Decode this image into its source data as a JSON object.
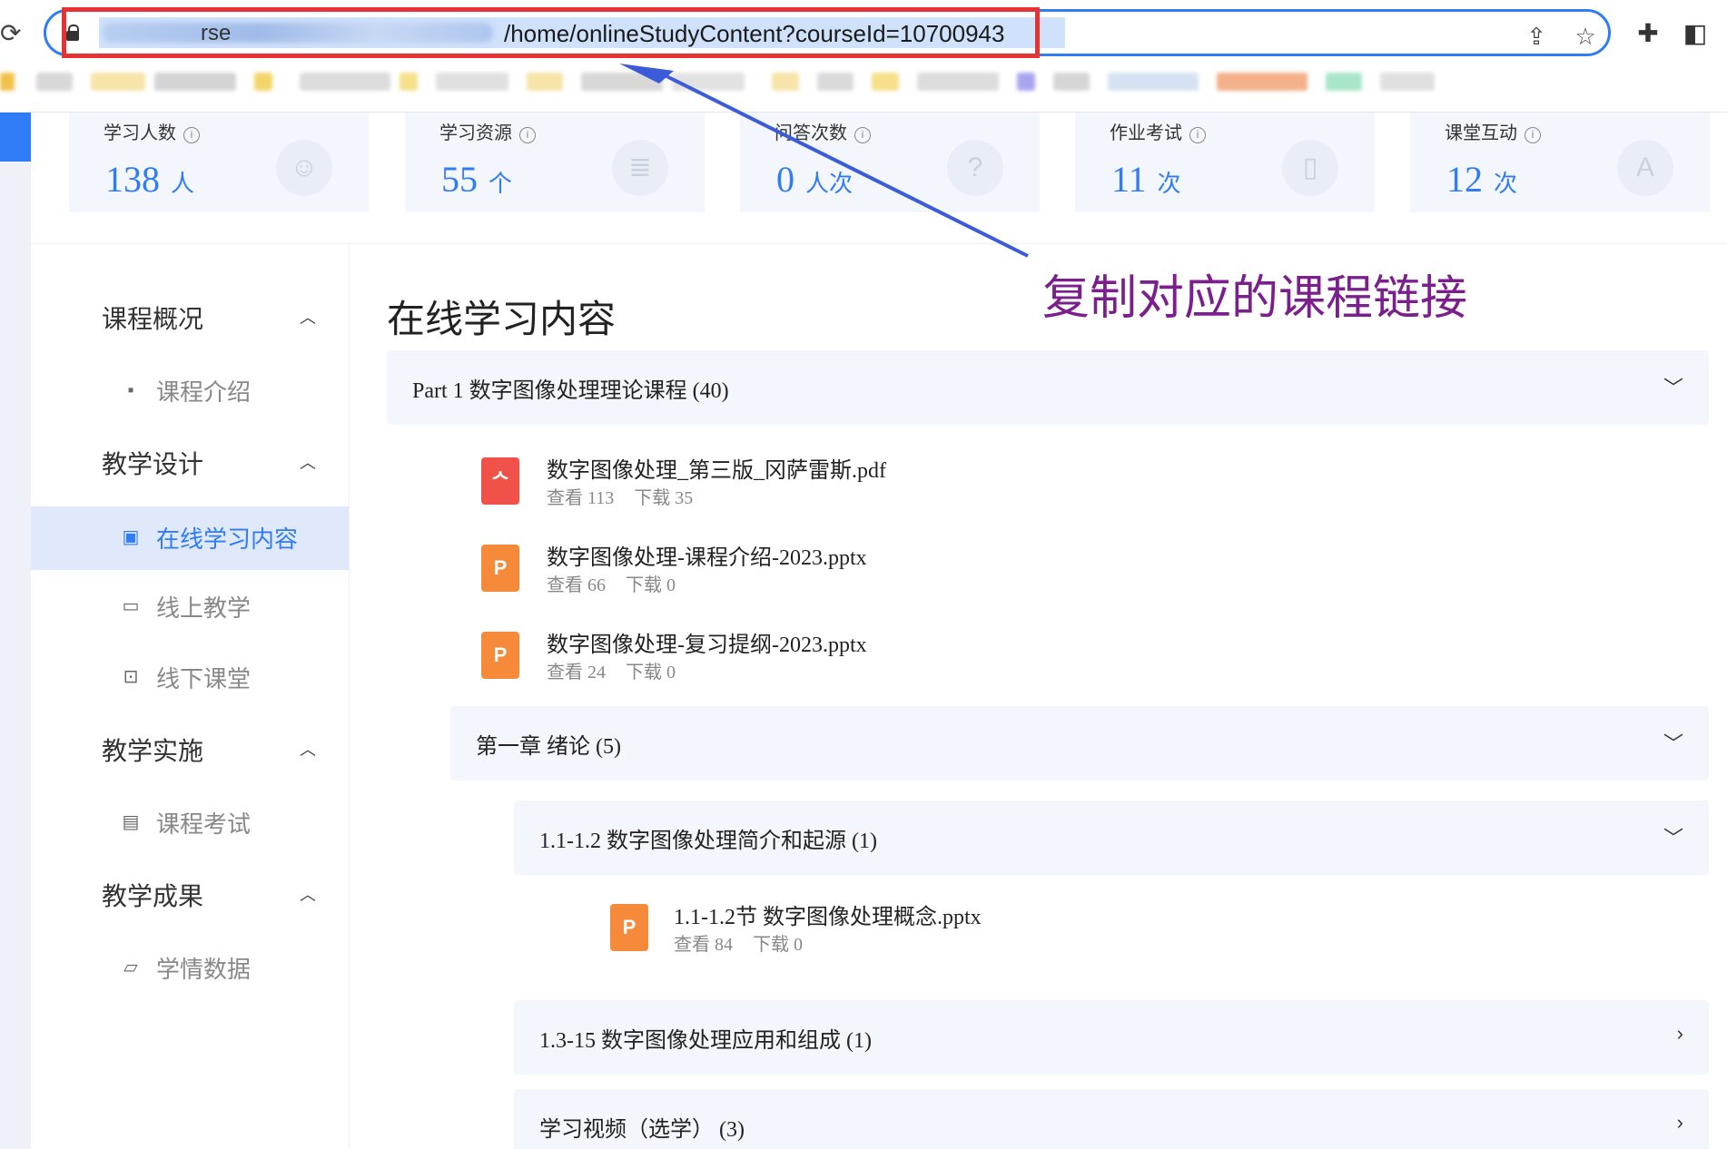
{
  "browser": {
    "url_visible": "/home/onlineStudyContent?courseId=10700943",
    "url_blurred_fragment": "rse",
    "icons": [
      "reload-icon",
      "lock-icon",
      "share-icon",
      "star-icon",
      "extensions-icon",
      "sidepanel-icon"
    ]
  },
  "stats": [
    {
      "label": "学习人数",
      "value": "138",
      "unit": "人",
      "icon": "student-icon"
    },
    {
      "label": "学习资源",
      "value": "55",
      "unit": "个",
      "icon": "database-icon"
    },
    {
      "label": "问答次数",
      "value": "0",
      "unit": "人次",
      "icon": "qa-icon"
    },
    {
      "label": "作业考试",
      "value": "11",
      "unit": "次",
      "icon": "book-icon"
    },
    {
      "label": "课堂互动",
      "value": "12",
      "unit": "次",
      "icon": "interaction-icon"
    }
  ],
  "sidebar": {
    "groups": [
      {
        "label": "课程概况",
        "items": [
          {
            "label": "课程介绍",
            "icon": "document-icon"
          }
        ]
      },
      {
        "label": "教学设计",
        "items": [
          {
            "label": "在线学习内容",
            "icon": "content-icon",
            "active": true
          },
          {
            "label": "线上教学",
            "icon": "online-class-icon"
          },
          {
            "label": "线下课堂",
            "icon": "offline-class-icon"
          }
        ]
      },
      {
        "label": "教学实施",
        "items": [
          {
            "label": "课程考试",
            "icon": "exam-icon"
          }
        ]
      },
      {
        "label": "教学成果",
        "items": [
          {
            "label": "学情数据",
            "icon": "chart-icon"
          }
        ]
      }
    ]
  },
  "main": {
    "title": "在线学习内容",
    "sections": [
      {
        "title": "Part 1 数字图像处理理论课程 (40)",
        "expanded": true
      },
      {
        "title": "第一章 绪论 (5)",
        "expanded": true
      },
      {
        "title": "1.1-1.2 数字图像处理简介和起源 (1)",
        "expanded": true
      },
      {
        "title": "1.3-15 数字图像处理应用和组成 (1)",
        "expanded": false
      },
      {
        "title": "学习视频（选学） (3)",
        "expanded": false
      }
    ],
    "files": [
      {
        "name": "数字图像处理_第三版_冈萨雷斯.pdf",
        "views": "查看 113",
        "downloads": "下载 35",
        "type": "pdf"
      },
      {
        "name": "数字图像处理-课程介绍-2023.pptx",
        "views": "查看 66",
        "downloads": "下载 0",
        "type": "ppt"
      },
      {
        "name": "数字图像处理-复习提纲-2023.pptx",
        "views": "查看 24",
        "downloads": "下载 0",
        "type": "ppt"
      },
      {
        "name": "1.1-1.2节 数字图像处理概念.pptx",
        "views": "查看 84",
        "downloads": "下载 0",
        "type": "ppt"
      }
    ],
    "ppt_letter": "P"
  },
  "annotation": {
    "text": "复制对应的课程链接",
    "color": "#7a1f8c",
    "arrow_color": "#3b5bdb",
    "frame_color": "#e63232"
  },
  "colors": {
    "accent": "#2f7cf6",
    "card_bg": "#f3f6fc",
    "active_bg": "#dfe9fb"
  }
}
